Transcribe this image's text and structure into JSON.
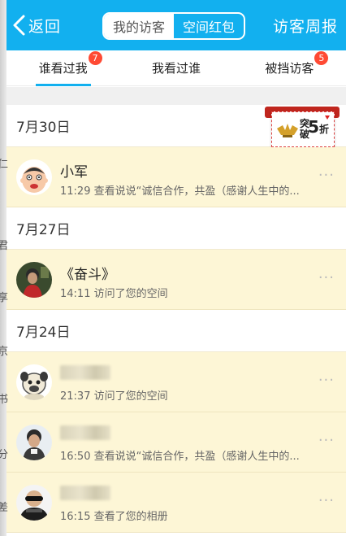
{
  "header": {
    "back_label": "返回",
    "segments": [
      {
        "label": "我的访客",
        "active": true
      },
      {
        "label": "空间红包",
        "active": false
      }
    ],
    "weekly_label": "访客周报",
    "bg_color": "#12b0ef"
  },
  "tabs": [
    {
      "label": "谁看过我",
      "badge": "7",
      "active": true
    },
    {
      "label": "我看过谁",
      "badge": "",
      "active": false
    },
    {
      "label": "被挡访客",
      "badge": "5",
      "active": false
    }
  ],
  "promo": {
    "line1": "突",
    "line2": "破",
    "big": "5",
    "unit": "折"
  },
  "groups": [
    {
      "date": "7月30日",
      "visitors": [
        {
          "name": "小军",
          "name_hidden": false,
          "time": "11:29",
          "action": "查看说说“诚信合作，共盈（感谢人生中的...",
          "avatar": "cartoon-avatar"
        }
      ]
    },
    {
      "date": "7月27日",
      "visitors": [
        {
          "name": "《奋斗》",
          "name_hidden": false,
          "time": "14:11",
          "action": "访问了您的空间",
          "avatar": "photo-avatar"
        }
      ]
    },
    {
      "date": "7月24日",
      "visitors": [
        {
          "name": "",
          "name_hidden": true,
          "time": "21:37",
          "action": "访问了您的空间",
          "avatar": "dog-avatar"
        },
        {
          "name": "",
          "name_hidden": true,
          "time": "16:50",
          "action": "查看说说“诚信合作，共盈（感谢人生中的...",
          "avatar": "child-avatar"
        },
        {
          "name": "",
          "name_hidden": true,
          "time": "16:15",
          "action": "查看了您的相册",
          "avatar": "sunglasses-avatar"
        }
      ]
    }
  ],
  "background_fragments": [
    "仁",
    "君",
    "享",
    "京",
    "书",
    "分",
    "差"
  ],
  "accent_colors": {
    "badge": "#ff4a34",
    "row_bg": "#fdf6d6",
    "tab_underline": "#12b0ef"
  }
}
